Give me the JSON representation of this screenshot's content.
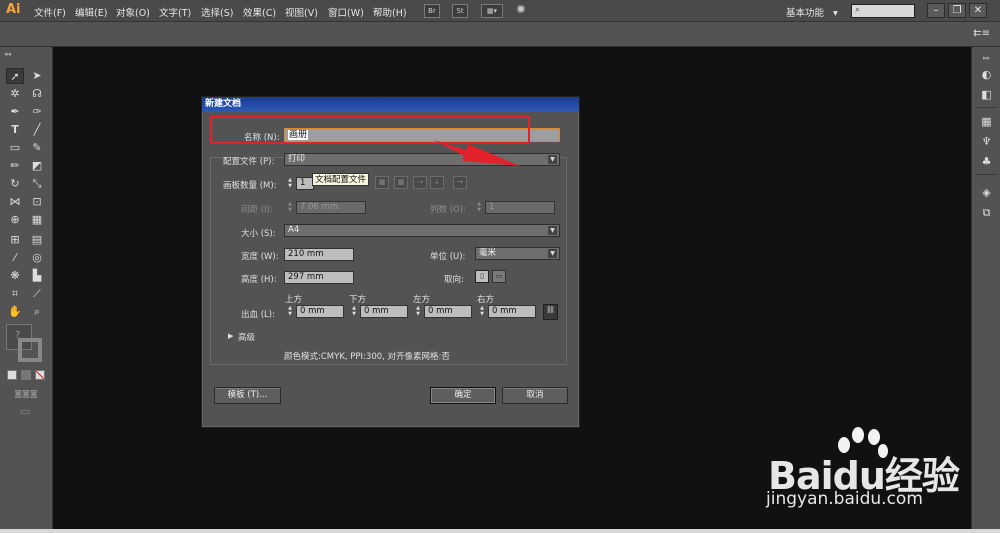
{
  "app": {
    "logo": "Ai"
  },
  "menu": [
    "文件(F)",
    "编辑(E)",
    "对象(O)",
    "文字(T)",
    "选择(S)",
    "效果(C)",
    "视图(V)",
    "窗口(W)",
    "帮助(H)"
  ],
  "menubar_icons": {
    "bridge": "Br",
    "stock": "St"
  },
  "workspace": {
    "label": "基本功能",
    "arrow": "▾"
  },
  "search": {
    "icon": "search-icon",
    "glyph": "⌕"
  },
  "window_controls": {
    "minimize": "–",
    "restore": "❐",
    "close": "✕"
  },
  "controlbar": {
    "panel_icon": "panel-menu-icon"
  },
  "dialog": {
    "title": "新建文档",
    "name_label": "名称 (N):",
    "name_value": "画册",
    "profile_label": "配置文件 (P):",
    "profile_value": "打印",
    "artboards_label": "画板数量 (M):",
    "artboards_value": "1",
    "tooltip": "文档配置文件",
    "spacing_label": "间距 (I):",
    "spacing_value": "7.06 mm",
    "columns_label": "列数 (O):",
    "columns_value": "1",
    "size_label": "大小 (S):",
    "size_value": "A4",
    "width_label": "宽度 (W):",
    "width_value": "210 mm",
    "units_label": "单位 (U):",
    "units_value": "毫米",
    "height_label": "高度 (H):",
    "height_value": "297 mm",
    "orientation_label": "取向:",
    "bleed_label": "出血 (L):",
    "bleed_top_label": "上方",
    "bleed_bottom_label": "下方",
    "bleed_left_label": "左方",
    "bleed_right_label": "右方",
    "bleed_top": "0 mm",
    "bleed_bottom": "0 mm",
    "bleed_left": "0 mm",
    "bleed_right": "0 mm",
    "advanced_label": "高级",
    "summary": "颜色模式:CMYK, PPI:300, 对齐像素网格:否",
    "templates_button": "模板 (T)...",
    "ok_button": "确定",
    "cancel_button": "取消"
  },
  "watermark": {
    "brand": "Baidu经验",
    "url": "jingyan.baidu.com"
  },
  "colors": {
    "annotation": "#e3212b",
    "title_bar": "#1a3c8c",
    "logo": "#f7a33c"
  }
}
